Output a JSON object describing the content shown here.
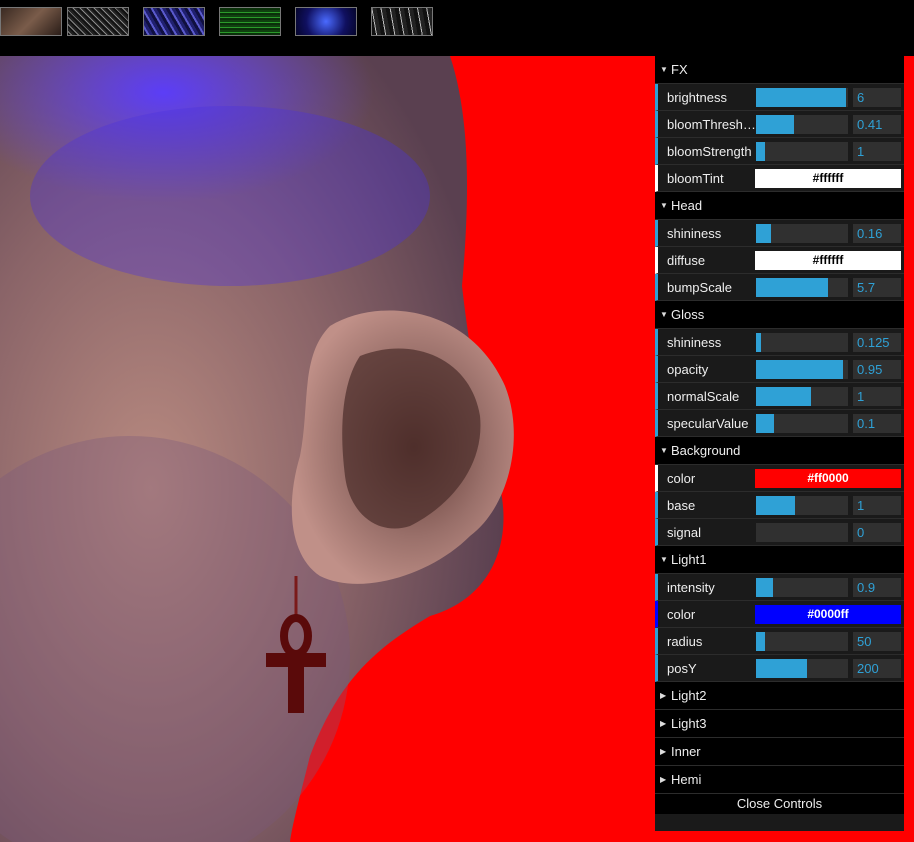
{
  "thumbnails": [
    {
      "name": "thumb-portrait"
    },
    {
      "name": "thumb-noise"
    },
    {
      "name": "thumb-blue-pattern"
    },
    {
      "name": "thumb-green-pattern"
    },
    {
      "name": "thumb-blue-glow"
    },
    {
      "name": "thumb-wireframe"
    }
  ],
  "gui": {
    "fx": {
      "title": "FX",
      "brightness": {
        "label": "brightness",
        "value": "6",
        "fill": 0.98
      },
      "bloomThreshold": {
        "label": "bloomThresho..",
        "value": "0.41",
        "fill": 0.41
      },
      "bloomStrength": {
        "label": "bloomStrength",
        "value": "1",
        "fill": 0.1
      },
      "bloomTint": {
        "label": "bloomTint",
        "value": "#ffffff",
        "bg": "#ffffff",
        "fg": "#000000"
      }
    },
    "head": {
      "title": "Head",
      "shininess": {
        "label": "shininess",
        "value": "0.16",
        "fill": 0.16
      },
      "diffuse": {
        "label": "diffuse",
        "value": "#ffffff",
        "bg": "#ffffff",
        "fg": "#000000"
      },
      "bumpScale": {
        "label": "bumpScale",
        "value": "5.7",
        "fill": 0.78
      }
    },
    "gloss": {
      "title": "Gloss",
      "shininess": {
        "label": "shininess",
        "value": "0.125",
        "fill": 0.05
      },
      "opacity": {
        "label": "opacity",
        "value": "0.95",
        "fill": 0.95
      },
      "normalScale": {
        "label": "normalScale",
        "value": "1",
        "fill": 0.6
      },
      "specularValue": {
        "label": "specularValue",
        "value": "0.1",
        "fill": 0.2
      }
    },
    "background": {
      "title": "Background",
      "color": {
        "label": "color",
        "value": "#ff0000",
        "bg": "#ff0000",
        "fg": "#ffffff"
      },
      "base": {
        "label": "base",
        "value": "1",
        "fill": 0.42
      },
      "signal": {
        "label": "signal",
        "value": "0",
        "fill": 0
      }
    },
    "light1": {
      "title": "Light1",
      "intensity": {
        "label": "intensity",
        "value": "0.9",
        "fill": 0.18
      },
      "color": {
        "label": "color",
        "value": "#0000ff",
        "bg": "#0000ff",
        "fg": "#ffffff"
      },
      "radius": {
        "label": "radius",
        "value": "50",
        "fill": 0.1
      },
      "posY": {
        "label": "posY",
        "value": "200",
        "fill": 0.55
      }
    },
    "light2": {
      "title": "Light2"
    },
    "light3": {
      "title": "Light3"
    },
    "inner": {
      "title": "Inner"
    },
    "hemi": {
      "title": "Hemi"
    },
    "close_label": "Close Controls"
  },
  "colors": {
    "accent": "#2fa1d6",
    "background": "#ff0000"
  },
  "icons": {
    "expanded": "triangle-down-icon",
    "collapsed": "triangle-right-icon"
  }
}
